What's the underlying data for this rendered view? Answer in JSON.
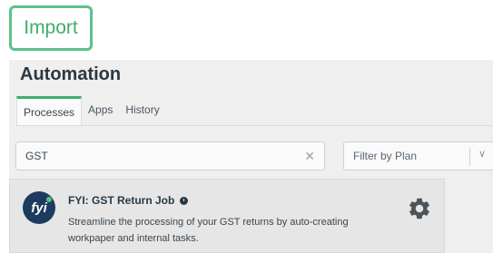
{
  "import_button": {
    "label": "Import"
  },
  "header": {
    "title": "Automation"
  },
  "tabs": [
    {
      "label": "Processes",
      "active": true
    },
    {
      "label": "Apps",
      "active": false
    },
    {
      "label": "History",
      "active": false
    }
  ],
  "search": {
    "value": "GST",
    "clear_icon": "close-icon"
  },
  "filter": {
    "placeholder": "Filter by Plan",
    "icon": "chevron-down-icon"
  },
  "card": {
    "logo_text": "fyi",
    "title": "FYI: GST Return Job",
    "description": "Streamline the processing of your GST returns by auto-creating workpaper and internal tasks.",
    "settings_icon": "gear-icon"
  },
  "colors": {
    "accent": "#3fae6a",
    "logo_bg": "#1d3b5f"
  }
}
